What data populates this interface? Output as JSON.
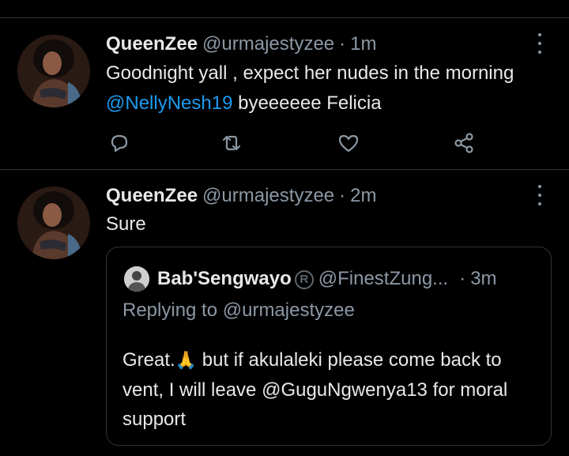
{
  "tweets": [
    {
      "display_name": "QueenZee",
      "handle": "@urmajestyzee",
      "separator": "·",
      "time": "1m",
      "text_before": "Goodnight yall , expect her nudes in the morning ",
      "mention": "@NellyNesh19",
      "text_after": "  byeeeeee Felicia",
      "actions": [
        "reply-icon",
        "retweet-icon",
        "like-icon",
        "share-icon"
      ]
    },
    {
      "display_name": "QueenZee",
      "handle": "@urmajestyzee",
      "separator": "·",
      "time": "2m",
      "text": "Sure",
      "quoted": {
        "display_name": "Bab'Sengwayo",
        "badge": "R",
        "handle": "@FinestZung...",
        "separator": "·",
        "time": "3m",
        "replying_to": "Replying to @urmajestyzee",
        "text_part1": "Great.",
        "emoji": "🙏",
        "text_part2": " but if akulaleki please come back to vent, I will leave @GuguNgwenya13 for moral support"
      }
    }
  ],
  "colors": {
    "background": "#000000",
    "text": "#e7e9ea",
    "secondary": "#8b98a5",
    "link": "#1d9bf0",
    "divider": "#2f3336"
  }
}
